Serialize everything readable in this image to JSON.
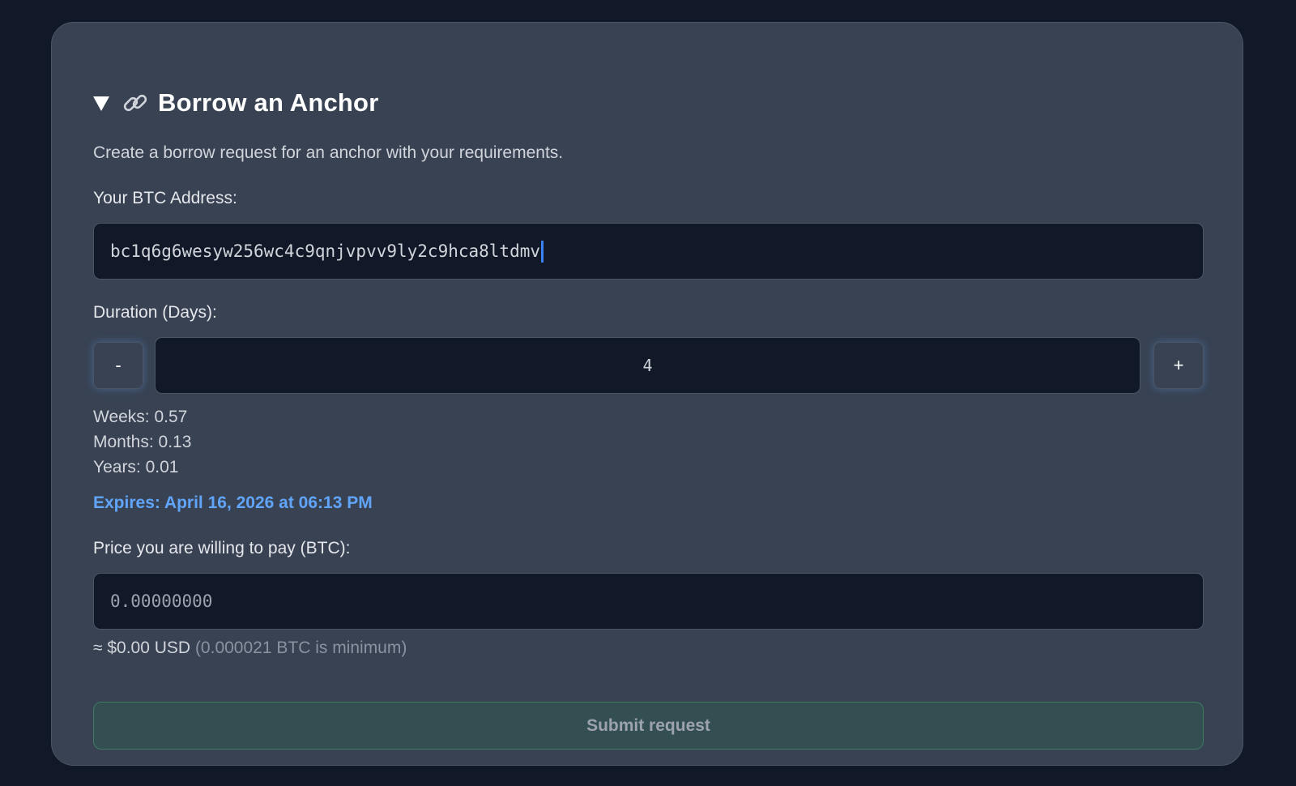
{
  "header": {
    "title": "Borrow an Anchor",
    "icon": "link-icon",
    "toggle_icon": "triangle-down-icon"
  },
  "description": "Create a borrow request for an anchor with your requirements.",
  "btc_address": {
    "label": "Your BTC Address:",
    "value": "bc1q6g6wesyw256wc4c9qnjvpvv9ly2c9hca8ltdmv"
  },
  "duration": {
    "label": "Duration (Days):",
    "decrement_label": "-",
    "increment_label": "+",
    "value": "4",
    "weeks": "Weeks: 0.57",
    "months": "Months: 0.13",
    "years": "Years: 0.01",
    "expires": "Expires: April 16, 2026 at 06:13 PM"
  },
  "price": {
    "label": "Price you are willing to pay (BTC):",
    "placeholder": "0.00000000",
    "usd_estimate": "≈ $0.00 USD",
    "minimum_hint": "(0.000021 BTC is minimum)"
  },
  "submit_label": "Submit request",
  "colors": {
    "page_bg": "#111827",
    "card_bg": "#384253",
    "accent": "#60a5fa",
    "submit_bg": "#344f52"
  }
}
